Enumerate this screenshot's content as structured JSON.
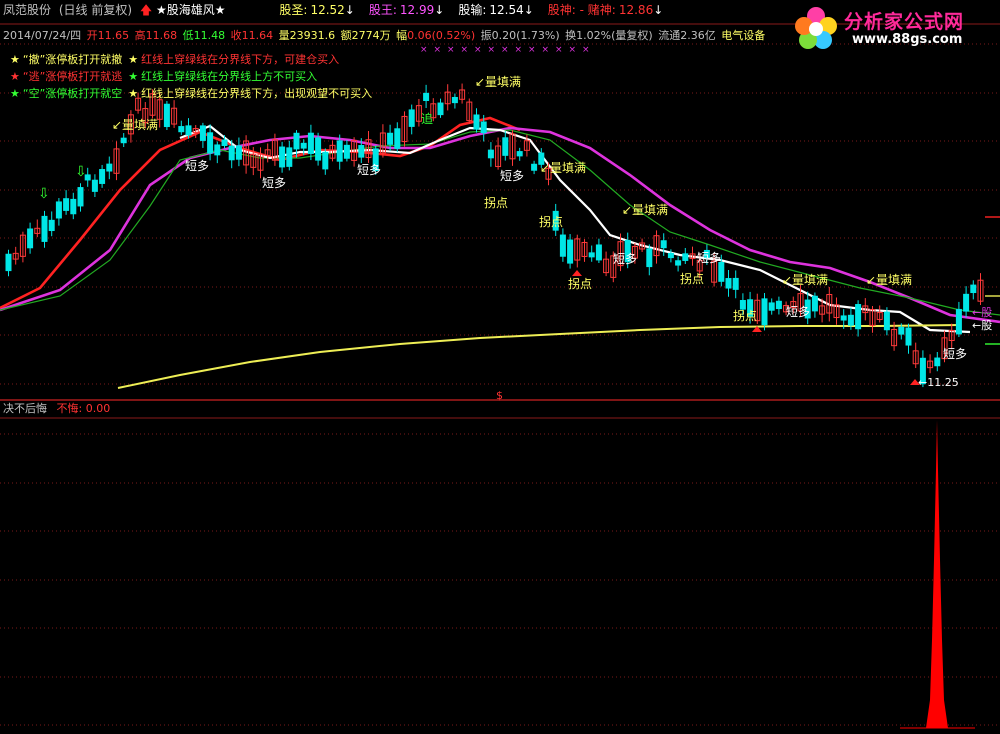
{
  "header": {
    "stock_name": "凤范股份",
    "period": "(日线 前复权)",
    "indicator_title": "★股海雄风★",
    "values": [
      {
        "label": "股圣:",
        "value": "12.52",
        "arrow": "↓",
        "color": "#ffff66"
      },
      {
        "label": "股王:",
        "value": "12.99",
        "arrow": "↓",
        "color": "#ff55ff"
      },
      {
        "label": "股输:",
        "value": "12.54",
        "arrow": "↓",
        "color": "#ffffff"
      },
      {
        "label": "股神: - 赌神:",
        "value": "12.86",
        "arrow": "↓",
        "color": "#ff3333"
      }
    ]
  },
  "info": {
    "date": "2014/07/24/四",
    "open_label": "开",
    "open": "11.65",
    "high_label": "高",
    "high": "11.68",
    "low_label": "低",
    "low": "11.48",
    "close_label": "收",
    "close": "11.64",
    "volume_label": "量",
    "volume": "23931.6",
    "amount_label": "额",
    "amount": "2774万",
    "change_label": "幅",
    "change": "0.06(0.52%)",
    "amplitude_label": "振",
    "amplitude": "0.20(1.73%)",
    "turnover_label": "换",
    "turnover": "1.02%(量复权)",
    "float_label": "流通",
    "float": "2.36亿",
    "sector": "电气设备"
  },
  "legend": [
    {
      "star_color": "#ffff66",
      "name": "“撤”",
      "name_color": "#ffff66",
      "text": "涨停板打开就撤",
      "star2_color": "#ffff66",
      "text2": "红线上穿绿线在分界线下方，可建仓买入",
      "text2_color": "#ff3333"
    },
    {
      "star_color": "#ff3333",
      "name": "“逃”",
      "name_color": "#ff3333",
      "text": "涨停板打开就逃",
      "star2_color": "#33ff33",
      "text2": "红线上穿绿线在分界线上方不可买入",
      "text2_color": "#33ff33"
    },
    {
      "star_color": "#33ff33",
      "name": "“空”",
      "name_color": "#33ff33",
      "text": "涨停板打开就空",
      "star2_color": "#ffff66",
      "text2": "红线上穿绿线在分界线下方，出现观望不可买入",
      "text2_color": "#ffff66"
    }
  ],
  "watermark": {
    "site_name": "分析家公式网",
    "site_url": "www.88gs.com"
  },
  "annotations": {
    "liang_tian_man": "量填满",
    "duan_duo": "短多",
    "guai_dian": "拐点",
    "zhui": "追",
    "low_price": "11.25",
    "right_label": "股",
    "dollar": "$"
  },
  "lower_panel": {
    "title": "决不后悔",
    "value_label": "不悔:",
    "value": "0.00"
  },
  "colors": {
    "up_candle": "#ff3a3a",
    "down_candle": "#00e6e6",
    "ma_red": "#ff2222",
    "ma_magenta": "#dd33dd",
    "ma_white": "#ffffff",
    "ma_green": "#22aa22",
    "ma_yellow": "#eeee55",
    "histogram": "#ff0000"
  }
}
